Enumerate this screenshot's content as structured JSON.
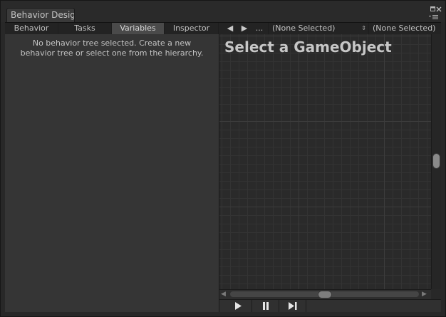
{
  "window": {
    "tab_title": "Behavior Desig",
    "icons": {
      "maximize": "maximize-icon",
      "close": "close-icon",
      "menu": "menu-icon"
    }
  },
  "toolbar": {
    "tabs": [
      "Behavior",
      "Tasks",
      "Variables",
      "Inspector"
    ],
    "active_tab": "Variables",
    "back_icon": "◀",
    "forward_icon": "▶",
    "more_label": "...",
    "gameobject_select": "(None Selected)",
    "tree_select": "(None Selected)",
    "dropdown_icon": "⇕"
  },
  "left_panel": {
    "message_line1": "No behavior tree selected. Create a new",
    "message_line2": "behavior tree or select one from the hierarchy."
  },
  "graph": {
    "title": "Select a GameObject"
  },
  "playback": {
    "buttons": [
      "play-icon",
      "pause-icon",
      "step-icon"
    ]
  }
}
